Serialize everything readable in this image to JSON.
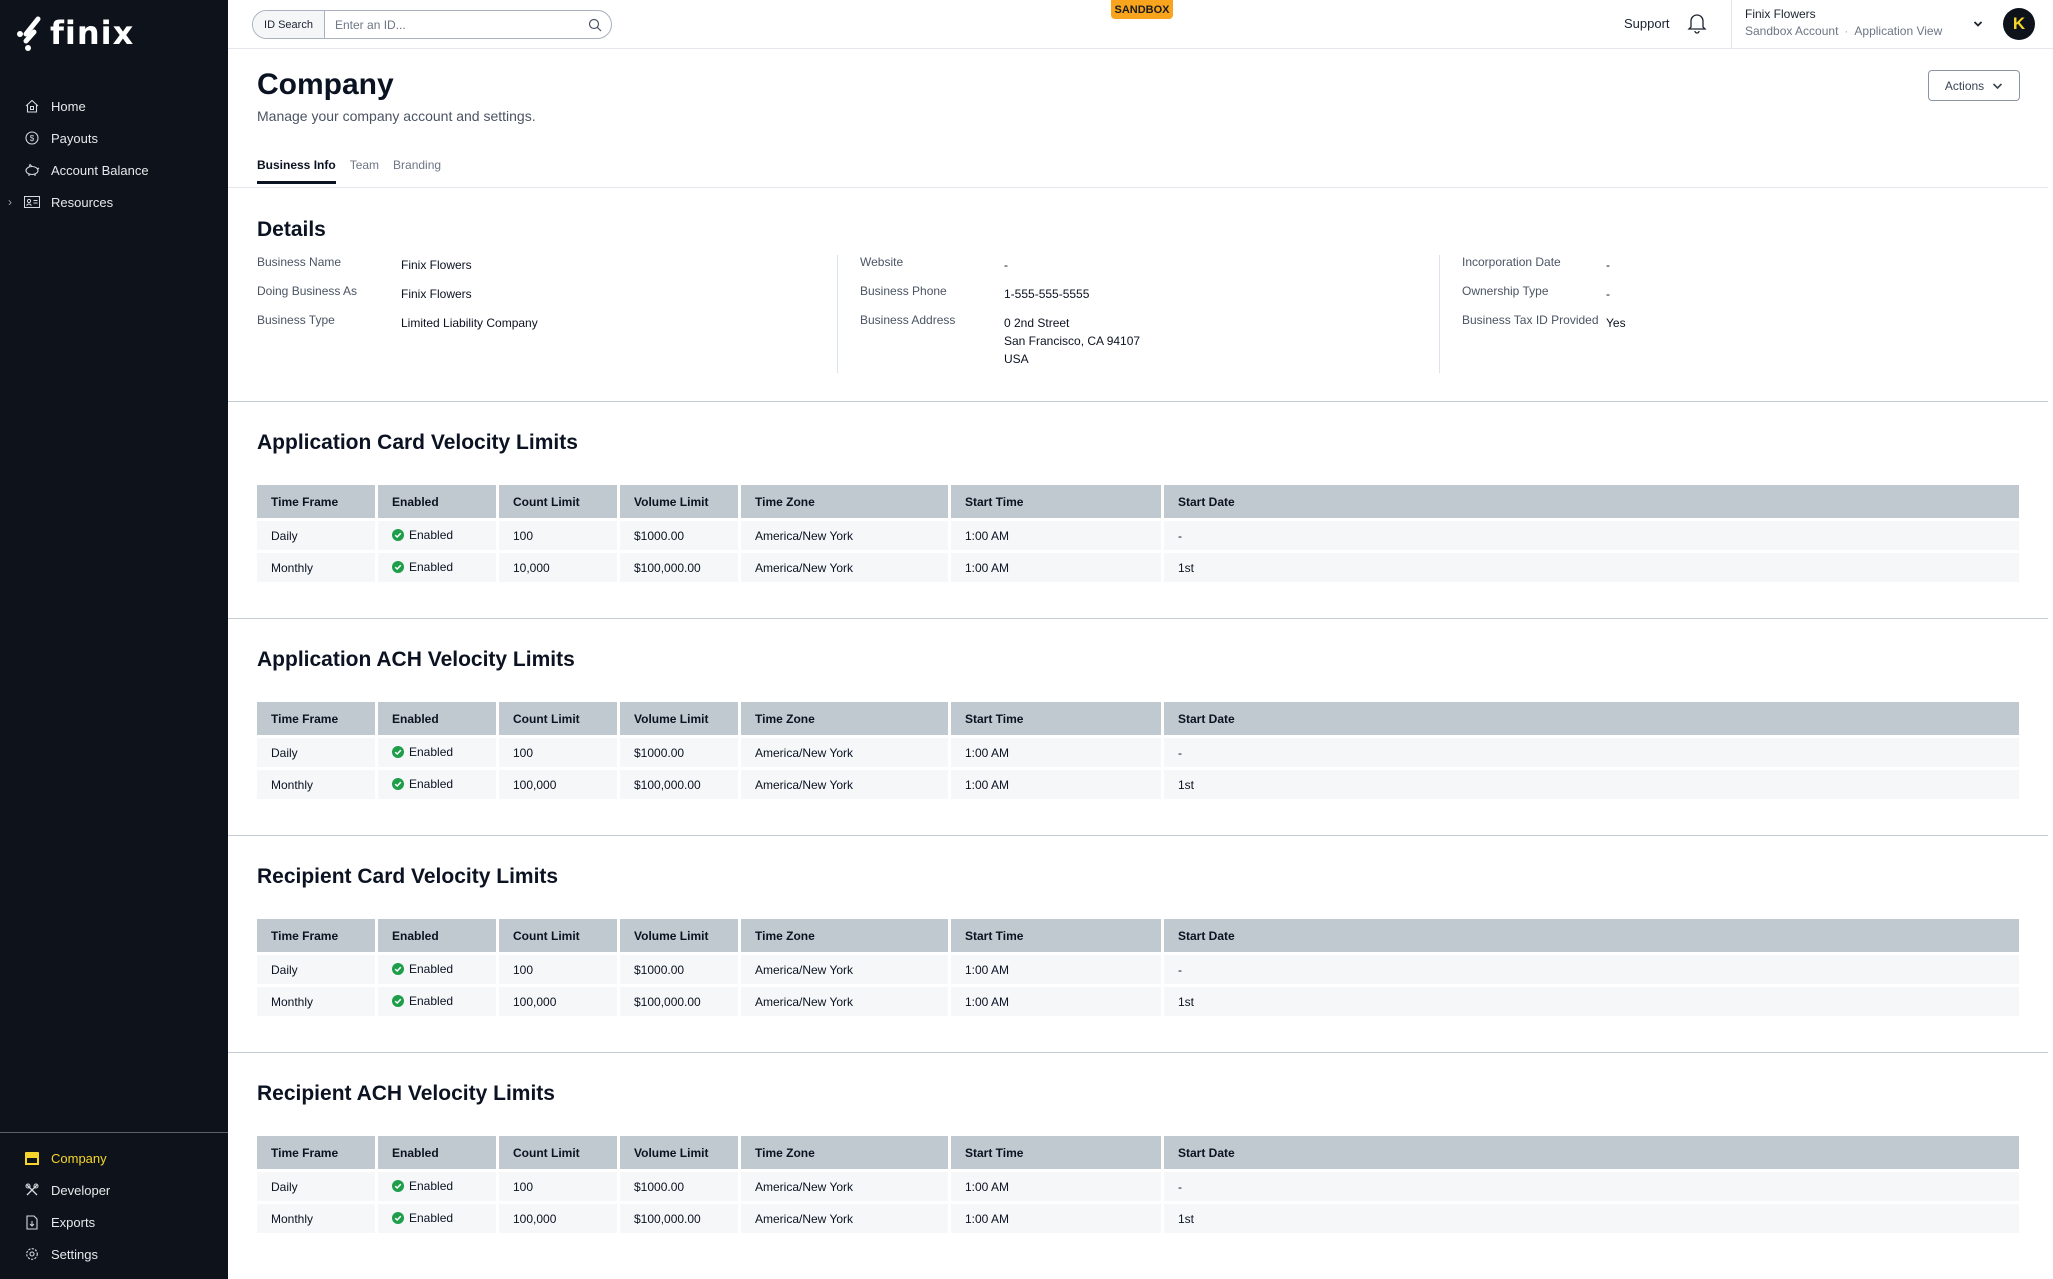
{
  "app": {
    "brand": "finix"
  },
  "sidebar": {
    "items": [
      {
        "label": "Home",
        "icon": "home-icon"
      },
      {
        "label": "Payouts",
        "icon": "dollar-circle-icon"
      },
      {
        "label": "Account Balance",
        "icon": "piggy-bank-icon"
      },
      {
        "label": "Resources",
        "icon": "id-card-icon",
        "expandable": true
      }
    ],
    "bottom_items": [
      {
        "label": "Company",
        "icon": "storefront-icon",
        "active": true
      },
      {
        "label": "Developer",
        "icon": "tools-icon"
      },
      {
        "label": "Exports",
        "icon": "file-download-icon"
      },
      {
        "label": "Settings",
        "icon": "gear-icon"
      }
    ]
  },
  "topbar": {
    "id_search_label": "ID Search",
    "id_search_placeholder": "Enter an ID...",
    "id_search_value": "",
    "environment_badge": "SANDBOX",
    "support_label": "Support",
    "account_name": "Finix Flowers",
    "account_type": "Sandbox Account",
    "account_view": "Application View",
    "avatar_initial": "K"
  },
  "page": {
    "title": "Company",
    "subtitle": "Manage your company account and settings.",
    "actions_label": "Actions",
    "tabs": [
      {
        "label": "Business Info",
        "active": true
      },
      {
        "label": "Team",
        "active": false
      },
      {
        "label": "Branding",
        "active": false
      }
    ]
  },
  "details": {
    "title": "Details",
    "columns": [
      [
        {
          "label": "Business Name",
          "value": "Finix Flowers"
        },
        {
          "label": "Doing Business As",
          "value": "Finix Flowers"
        },
        {
          "label": "Business Type",
          "value": "Limited Liability Company"
        }
      ],
      [
        {
          "label": "Website",
          "value": "-"
        },
        {
          "label": "Business Phone",
          "value": "1-555-555-5555"
        },
        {
          "label": "Business Address",
          "value_lines": [
            "0 2nd Street",
            "San Francisco, CA 94107",
            "USA"
          ]
        }
      ],
      [
        {
          "label": "Incorporation Date",
          "value": "-"
        },
        {
          "label": "Ownership Type",
          "value": "-"
        },
        {
          "label": "Business Tax ID Provided",
          "value": "Yes"
        }
      ]
    ]
  },
  "velocity_columns": [
    "Time Frame",
    "Enabled",
    "Count Limit",
    "Volume Limit",
    "Time Zone",
    "Start Time",
    "Start Date"
  ],
  "velocity_sections": [
    {
      "title": "Application Card Velocity Limits",
      "rows": [
        {
          "time_frame": "Daily",
          "enabled": "Enabled",
          "count_limit": "100",
          "volume_limit": "$1000.00",
          "time_zone": "America/New York",
          "start_time": "1:00 AM",
          "start_date": "-"
        },
        {
          "time_frame": "Monthly",
          "enabled": "Enabled",
          "count_limit": "10,000",
          "volume_limit": "$100,000.00",
          "time_zone": "America/New York",
          "start_time": "1:00 AM",
          "start_date": "1st"
        }
      ]
    },
    {
      "title": "Application ACH Velocity Limits",
      "rows": [
        {
          "time_frame": "Daily",
          "enabled": "Enabled",
          "count_limit": "100",
          "volume_limit": "$1000.00",
          "time_zone": "America/New York",
          "start_time": "1:00 AM",
          "start_date": "-"
        },
        {
          "time_frame": "Monthly",
          "enabled": "Enabled",
          "count_limit": "100,000",
          "volume_limit": "$100,000.00",
          "time_zone": "America/New York",
          "start_time": "1:00 AM",
          "start_date": "1st"
        }
      ]
    },
    {
      "title": "Recipient Card Velocity Limits",
      "rows": [
        {
          "time_frame": "Daily",
          "enabled": "Enabled",
          "count_limit": "100",
          "volume_limit": "$1000.00",
          "time_zone": "America/New York",
          "start_time": "1:00 AM",
          "start_date": "-"
        },
        {
          "time_frame": "Monthly",
          "enabled": "Enabled",
          "count_limit": "100,000",
          "volume_limit": "$100,000.00",
          "time_zone": "America/New York",
          "start_time": "1:00 AM",
          "start_date": "1st"
        }
      ]
    },
    {
      "title": "Recipient ACH Velocity Limits",
      "rows": [
        {
          "time_frame": "Daily",
          "enabled": "Enabled",
          "count_limit": "100",
          "volume_limit": "$1000.00",
          "time_zone": "America/New York",
          "start_time": "1:00 AM",
          "start_date": "-"
        },
        {
          "time_frame": "Monthly",
          "enabled": "Enabled",
          "count_limit": "100,000",
          "volume_limit": "$100,000.00",
          "time_zone": "America/New York",
          "start_time": "1:00 AM",
          "start_date": "1st"
        }
      ]
    }
  ],
  "colors": {
    "sidebar_bg": "#0e131b",
    "active_nav": "#f5d52b",
    "sandbox_badge": "#f8a51d",
    "enabled_check": "#1e9e4a",
    "table_header": "#c1c9d0",
    "table_row": "#f5f7f9"
  }
}
